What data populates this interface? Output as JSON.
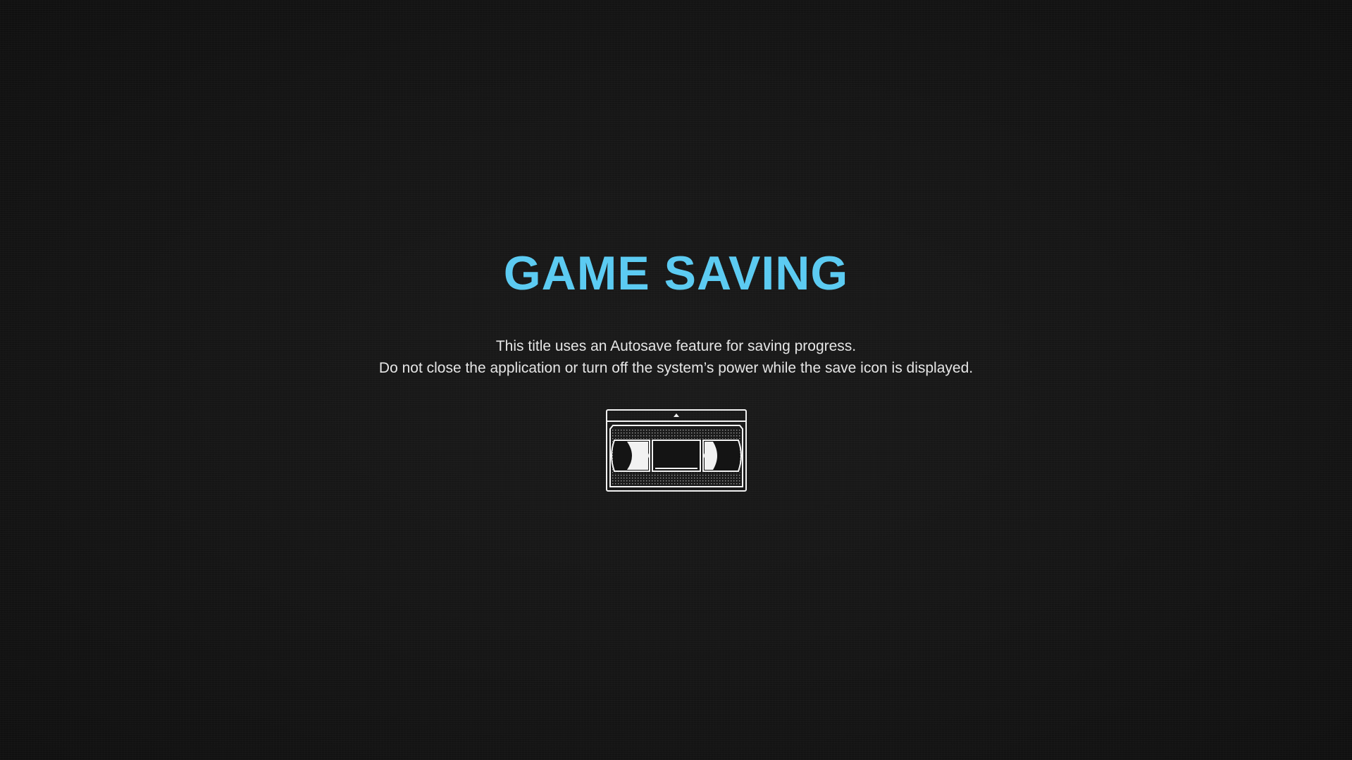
{
  "screen": {
    "title": "GAME SAVING",
    "message_lines": [
      "This title uses an Autosave feature for saving progress.",
      "Do not close the application or turn off the system’s power while the save icon is displayed."
    ],
    "save_icon": "vhs-cassette-icon"
  },
  "colors": {
    "background": "#141414",
    "title": "#5ccbf2",
    "text": "#e6e6e6",
    "icon": "#f2f2f2"
  }
}
